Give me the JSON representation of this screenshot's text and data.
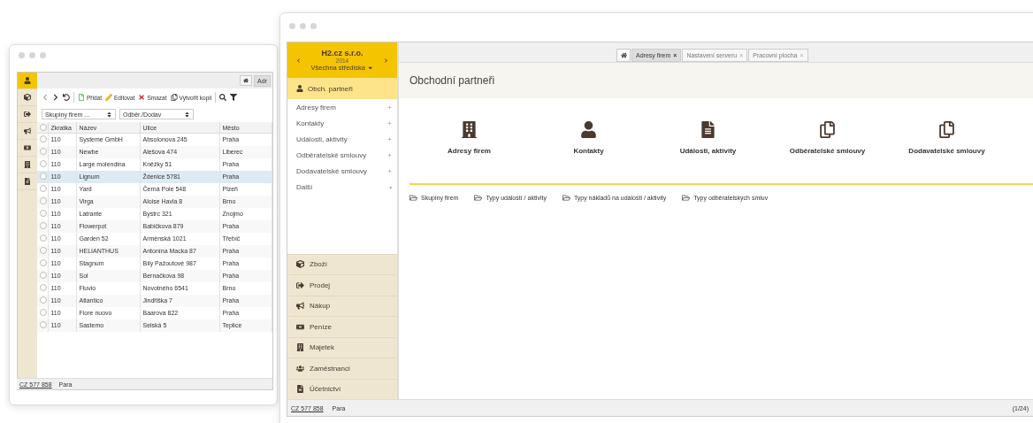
{
  "back_window": {
    "rail": [
      {
        "selected": true
      },
      {
        "selected": false
      },
      {
        "selected": false
      },
      {
        "selected": false
      },
      {
        "selected": false
      },
      {
        "selected": false
      },
      {
        "selected": false
      }
    ],
    "tabs": [
      {
        "label": "Adr",
        "selected": true
      }
    ],
    "toolbar": [
      {
        "kind": "add",
        "label": "Přidat"
      },
      {
        "kind": "edit",
        "label": "Editovat"
      },
      {
        "kind": "delete",
        "label": "Smazat"
      },
      {
        "kind": "copy",
        "label": "Vytvořit kopii"
      }
    ],
    "filters": [
      {
        "value": "Skupiny firem ..."
      },
      {
        "value": "Odběr./Dodav"
      }
    ],
    "table": {
      "all_checked": false,
      "columns": [
        "Zkratka",
        "Název",
        "Ulice",
        "Město"
      ],
      "rows": [
        {
          "cells": [
            "110",
            "Systeme GmbH",
            "Absolonova 245",
            "Praha"
          ],
          "selected": false,
          "checked": false
        },
        {
          "cells": [
            "110",
            "Newbe",
            "Alešova 474",
            "Liberec"
          ],
          "selected": false,
          "checked": false
        },
        {
          "cells": [
            "110",
            "Large molendina",
            "Kněžky 51",
            "Praha"
          ],
          "selected": false,
          "checked": false
        },
        {
          "cells": [
            "110",
            "Lignum",
            "Ždenice 5781",
            "Praha"
          ],
          "selected": true,
          "checked": false
        },
        {
          "cells": [
            "110",
            "Yard",
            "Černá Pole 548",
            "Plzeň"
          ],
          "selected": false,
          "checked": false
        },
        {
          "cells": [
            "110",
            "Virga",
            "Aloise Havla 8",
            "Brno"
          ],
          "selected": false,
          "checked": false
        },
        {
          "cells": [
            "110",
            "Latrante",
            "Bystrc 321",
            "Znojmo"
          ],
          "selected": false,
          "checked": false
        },
        {
          "cells": [
            "110",
            "Flowerpot",
            "Babičkova 879",
            "Praha"
          ],
          "selected": false,
          "checked": false
        },
        {
          "cells": [
            "110",
            "Garden 52",
            "Arménská 1021",
            "Třebíč"
          ],
          "selected": false,
          "checked": false
        },
        {
          "cells": [
            "110",
            "HELIANTHUS",
            "Antonína Macka 87",
            "Praha"
          ],
          "selected": false,
          "checked": false
        },
        {
          "cells": [
            "110",
            "Stagnum",
            "Bíly Pažoutové 987",
            "Praha"
          ],
          "selected": false,
          "checked": false
        },
        {
          "cells": [
            "110",
            "Sol",
            "Bernačkova 98",
            "Praha"
          ],
          "selected": false,
          "checked": false
        },
        {
          "cells": [
            "110",
            "Fluvio",
            "Novotného 6541",
            "Brno"
          ],
          "selected": false,
          "checked": false
        },
        {
          "cells": [
            "110",
            "Atlantico",
            "Jindřiška 7",
            "Praha"
          ],
          "selected": false,
          "checked": false
        },
        {
          "cells": [
            "110",
            "Fiore nuovo",
            "Baarova 822",
            "Praha"
          ],
          "selected": false,
          "checked": false
        },
        {
          "cells": [
            "110",
            "Sastemo",
            "Selská 5",
            "Teplice"
          ],
          "selected": false,
          "checked": false
        }
      ]
    },
    "status_bar": [
      "CZ 577 858",
      "Para"
    ]
  },
  "front_window": {
    "company": {
      "name": "H2.cz s.r.o.",
      "year": "2014",
      "centre": "Všechna střediska"
    },
    "active_module": {
      "label": "Obch. partneři",
      "selected": true
    },
    "submenu": [
      {
        "label": "Adresy firem",
        "marker": "+"
      },
      {
        "label": "Kontakty",
        "marker": "+"
      },
      {
        "label": "Události, aktivity",
        "marker": "+"
      },
      {
        "label": "Odběratelské smlouvy",
        "marker": "+"
      },
      {
        "label": "Dodavatelské smlouvy",
        "marker": "+"
      },
      {
        "label": "Další",
        "marker": "•"
      }
    ],
    "modules": [
      {
        "label": "Zboží",
        "selected": false
      },
      {
        "label": "Prodej",
        "selected": false
      },
      {
        "label": "Nákup",
        "selected": false
      },
      {
        "label": "Peníze",
        "selected": false
      },
      {
        "label": "Majetek",
        "selected": false
      },
      {
        "label": "Zaměstnanci",
        "selected": false
      },
      {
        "label": "Účetnictví",
        "selected": false
      }
    ],
    "tabs": [
      {
        "label": "Adresy firem",
        "close": "×",
        "selected": true
      },
      {
        "label": "Nastavení serveru",
        "close": "×",
        "selected": false
      },
      {
        "label": "Pracovní plocha",
        "close": "×",
        "selected": false
      }
    ],
    "page_title": "Obchodní partneři",
    "tiles": [
      {
        "kind": "building",
        "label": "Adresy firem"
      },
      {
        "kind": "person",
        "label": "Kontakty"
      },
      {
        "kind": "document",
        "label": "Události, aktivity"
      },
      {
        "kind": "copy",
        "label": "Odběratelské smlouvy"
      },
      {
        "kind": "copy",
        "label": "Dodavatelské smlouvy"
      }
    ],
    "links": [
      "Skupiny firem",
      "Typy událostí / aktivity",
      "Typy nákladů na události / aktivity",
      "Typy odběratelských smluv"
    ],
    "status_bar": {
      "left": [
        "CZ 577 858",
        "Para"
      ],
      "right": "(1/24)"
    }
  }
}
